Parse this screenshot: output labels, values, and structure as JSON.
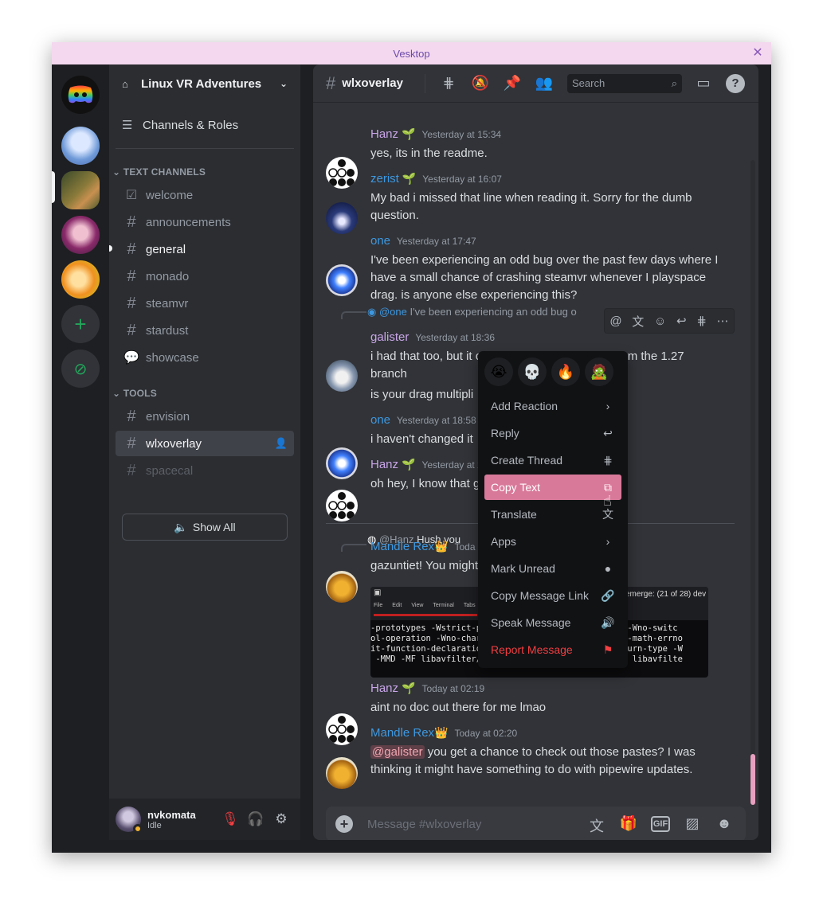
{
  "window": {
    "title": "Vesktop",
    "close_glyph": "✕"
  },
  "servers": [
    {
      "name": "discord-home",
      "color": "#5b3fd0"
    },
    {
      "name": "server-cirno",
      "color": "#9fb6e8"
    },
    {
      "name": "server-landscape",
      "color": "#6a7a3a"
    },
    {
      "name": "server-anime-girl",
      "color": "#8a3a6a"
    },
    {
      "name": "server-orange-girl",
      "color": "#e8a020"
    }
  ],
  "sidebar": {
    "guild_name": "Linux VR Adventures",
    "channels_roles": "Channels & Roles",
    "category_text": "TEXT CHANNELS",
    "category_tools": "TOOLS",
    "text_channels": [
      {
        "name": "welcome",
        "icon": "rules-icon"
      },
      {
        "name": "announcements",
        "icon": "hash-icon"
      },
      {
        "name": "general",
        "icon": "hash-icon"
      },
      {
        "name": "monado",
        "icon": "hash-icon"
      },
      {
        "name": "steamvr",
        "icon": "hash-icon"
      },
      {
        "name": "stardust",
        "icon": "hash-icon"
      },
      {
        "name": "showcase",
        "icon": "forum-icon"
      }
    ],
    "tool_channels": [
      {
        "name": "envision"
      },
      {
        "name": "wlxoverlay"
      },
      {
        "name": "spacecal"
      }
    ],
    "show_all": "Show All",
    "user": {
      "name": "nvkomata",
      "status": "Idle"
    }
  },
  "header": {
    "channel": "wlxoverlay",
    "search_placeholder": "Search"
  },
  "messages": [
    {
      "author": "Hanz",
      "time": "Yesterday at 15:34",
      "text": "yes, its in the readme."
    },
    {
      "author": "zerist",
      "time": "Yesterday at 16:07",
      "text": "My bad i missed that line when reading it. Sorry for the dumb question."
    },
    {
      "author": "one",
      "time": "Yesterday at 17:47",
      "text": "I've been experiencing an odd bug over the past few days where I have a small chance of crashing steamvr whenever I playspace drag. is anyone else experiencing this?"
    },
    {
      "reply_to": "@one",
      "reply_text": "I've been experiencing an odd bug o",
      "author": "galister",
      "time": "Yesterday at 18:36",
      "text": "i had that too, but it only started after i update from the 1.27 branch",
      "text2": "is your drag multipli"
    },
    {
      "author": "one",
      "time": "Yesterday at 18:58",
      "text": "i haven't changed it"
    },
    {
      "author": "Hanz",
      "time": "Yesterday at 2",
      "text": "oh hey, I know that g"
    },
    {
      "reply_to": "@Hanz",
      "reply_text": "Hush you",
      "author": "Mandle Rex",
      "time": "Toda",
      "text": "gazuntiet! You might"
    },
    {
      "author": "Hanz",
      "time": "Today at 02:19",
      "text": "aint no doc out there for me lmao"
    },
    {
      "author": "Mandle Rex",
      "time": "Today at 02:20",
      "mention": "@galister",
      "text": " you get a chance to check out those pastes? I was thinking it might have something to do with pipewire updates."
    }
  ],
  "embed": {
    "menu": [
      "File",
      "Edit",
      "View",
      "Terminal",
      "Tabs",
      "H"
    ],
    "title_right": "emerge: (21 of 28) dev",
    "lines": [
      "-prototypes -Wstrict-pro                    theses -Wno-switc",
      "ol-operation -Wno-char-                     pe -fno-math-errno",
      "it-function-declaration                     ror=return-type -W",
      " -MMD -MF libavfilter/                      o -c -o libavfilte"
    ]
  },
  "composer": {
    "placeholder": "Message #wlxoverlay"
  },
  "context_menu": {
    "reactions": [
      "😭",
      "💀",
      "🔥",
      "🧟"
    ],
    "items": [
      {
        "label": "Add Reaction",
        "icon": "›"
      },
      {
        "label": "Reply",
        "icon": "↩"
      },
      {
        "label": "Create Thread",
        "icon": "⋕"
      },
      {
        "label": "Copy Text",
        "icon": "⧉"
      },
      {
        "label": "Translate",
        "icon": "文"
      },
      {
        "label": "Apps",
        "icon": "›"
      },
      {
        "label": "Mark Unread",
        "icon": "●"
      },
      {
        "label": "Copy Message Link",
        "icon": "🔗"
      },
      {
        "label": "Speak Message",
        "icon": "🔊"
      },
      {
        "label": "Report Message",
        "icon": "⚑"
      }
    ]
  },
  "colors": {
    "accent_pink": "#d9799a",
    "danger": "#f23f42",
    "online_green": "#23a55a"
  }
}
